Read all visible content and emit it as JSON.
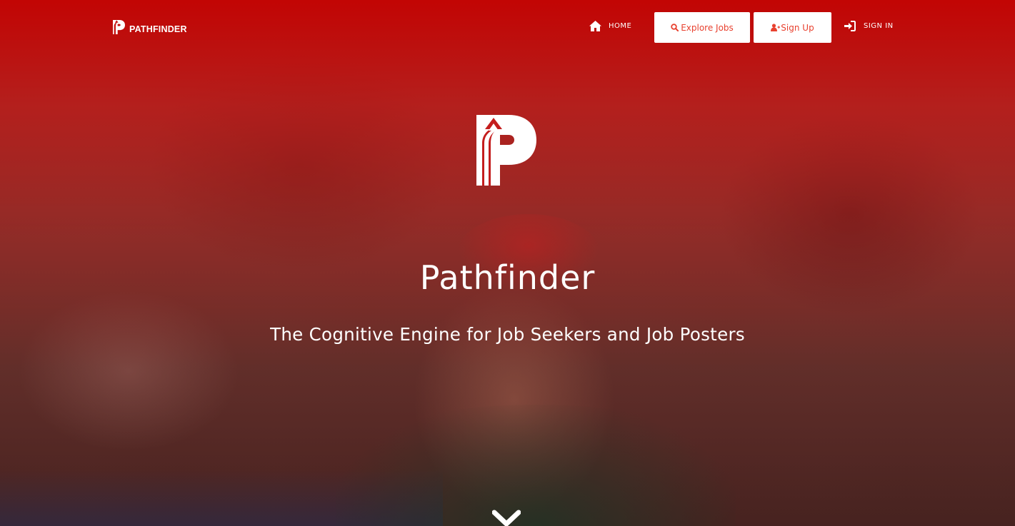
{
  "nav": {
    "brand": "PATHFINDER",
    "home_label": "HOME",
    "explore_label": "Explore Jobs",
    "signup_label": "Sign Up",
    "signin_label": "SIGN IN",
    "icons": {
      "brand": "pathfinder-logo-icon",
      "home": "home-icon",
      "explore": "search-icon",
      "signup": "user-plus-icon",
      "signin": "sign-in-icon"
    }
  },
  "hero": {
    "title": "Pathfinder",
    "subtitle": "The Cognitive Engine for Job Seekers and Job Posters",
    "scroll_icon": "chevron-down-icon"
  },
  "colors": {
    "accent": "#e8412f",
    "overlay_red": "#cc0000",
    "text": "#ffffff"
  }
}
